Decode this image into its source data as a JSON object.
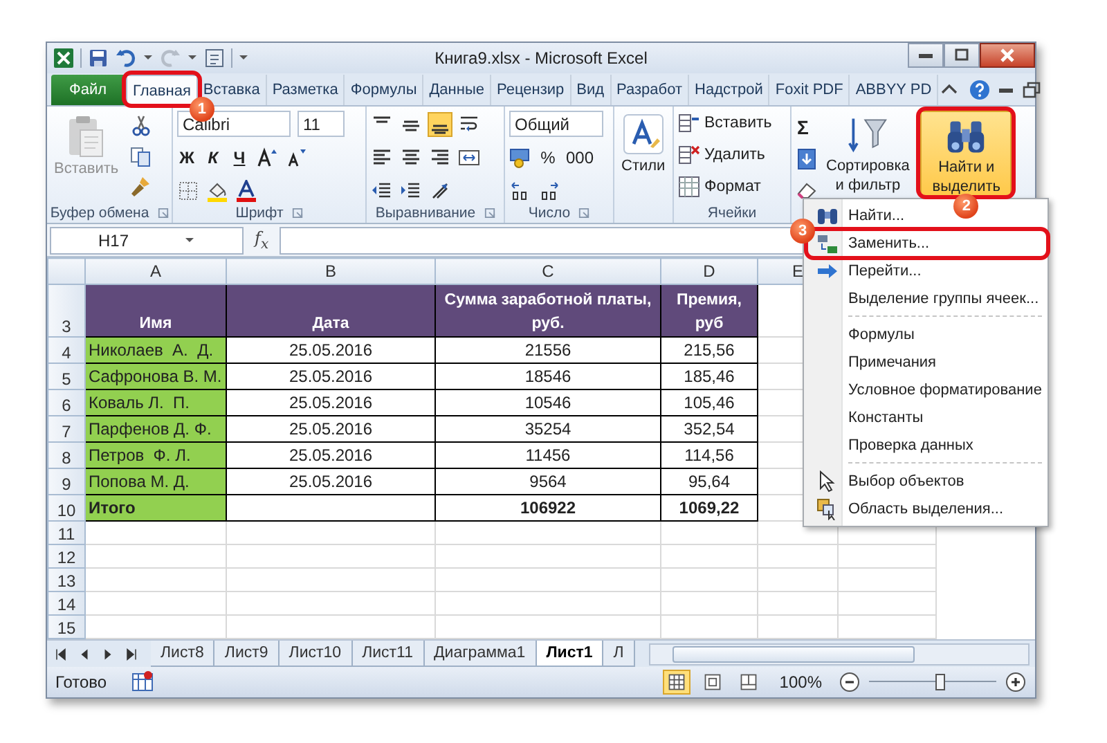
{
  "window": {
    "title": "Книга9.xlsx - Microsoft Excel"
  },
  "tabs": [
    {
      "label": "Файл",
      "kind": "file",
      "selected": false
    },
    {
      "label": "Главная",
      "kind": "tab",
      "selected": true,
      "callout": "1"
    },
    {
      "label": "Вставка",
      "kind": "tab",
      "selected": false
    },
    {
      "label": "Разметка",
      "kind": "tab",
      "selected": false
    },
    {
      "label": "Формулы",
      "kind": "tab",
      "selected": false
    },
    {
      "label": "Данные",
      "kind": "tab",
      "selected": false
    },
    {
      "label": "Рецензир",
      "kind": "tab",
      "selected": false
    },
    {
      "label": "Вид",
      "kind": "tab",
      "selected": false
    },
    {
      "label": "Разработ",
      "kind": "tab",
      "selected": false
    },
    {
      "label": "Надстрой",
      "kind": "tab",
      "selected": false
    },
    {
      "label": "Foxit PDF",
      "kind": "tab",
      "selected": false
    },
    {
      "label": "ABBYY PD",
      "kind": "tab",
      "selected": false
    }
  ],
  "ribbon": {
    "clipboard": {
      "paste": {
        "label": "Вставить",
        "disabled": true
      },
      "group_label": "Буфер обмена"
    },
    "font": {
      "name": "Calibri",
      "size": "11",
      "bold": "Ж",
      "italic": "К",
      "underline": "Ч",
      "group_label": "Шрифт"
    },
    "alignment": {
      "group_label": "Выравнивание"
    },
    "number": {
      "format": "Общий",
      "percent": "%",
      "thousands": "000",
      "group_label": "Число"
    },
    "styles": {
      "label": "Стили"
    },
    "cells": {
      "items": [
        "Вставить",
        "Удалить",
        "Формат"
      ],
      "group_label": "Ячейки"
    },
    "editing": {
      "sum": "Σ",
      "sort": {
        "lines": [
          "Сортировка",
          "и фильтр"
        ]
      },
      "find": {
        "lines": [
          "Найти и",
          "выделить"
        ],
        "selected": true,
        "callout": "2"
      }
    }
  },
  "formula_bar": {
    "name_box": "H17",
    "fx": "f$_{x}$"
  },
  "sheet": {
    "columns": [
      "A",
      "B",
      "C",
      "D",
      "E"
    ],
    "rows": [
      {
        "number": "3",
        "kind": "header",
        "cells": [
          "Имя",
          "Дата",
          "Сумма заработной платы, руб.",
          "Премия, руб"
        ]
      },
      {
        "number": "4",
        "kind": "data",
        "cells": [
          "Николаев  А.  Д.",
          "25.05.2016",
          "21556",
          "215,56"
        ]
      },
      {
        "number": "5",
        "kind": "data",
        "cells": [
          "Сафронова В. М.",
          "25.05.2016",
          "18546",
          "185,46"
        ]
      },
      {
        "number": "6",
        "kind": "data",
        "cells": [
          "Коваль Л.  П.",
          "25.05.2016",
          "10546",
          "105,46"
        ]
      },
      {
        "number": "7",
        "kind": "data",
        "cells": [
          "Парфенов Д. Ф.",
          "25.05.2016",
          "35254",
          "352,54"
        ]
      },
      {
        "number": "8",
        "kind": "data",
        "cells": [
          "Петров  Ф. Л.",
          "25.05.2016",
          "11456",
          "114,56"
        ]
      },
      {
        "number": "9",
        "kind": "data",
        "cells": [
          "Попова М. Д.",
          "25.05.2016",
          "9564",
          "95,64"
        ]
      },
      {
        "number": "10",
        "kind": "total",
        "cells": [
          "Итого",
          "",
          "106922",
          "1069,22"
        ]
      },
      {
        "number": "11",
        "kind": "empty"
      },
      {
        "number": "12",
        "kind": "empty"
      },
      {
        "number": "13",
        "kind": "empty"
      },
      {
        "number": "14",
        "kind": "empty"
      },
      {
        "number": "15",
        "kind": "empty"
      }
    ]
  },
  "sheet_tabs": [
    {
      "label": "Лист8",
      "selected": false
    },
    {
      "label": "Лист9",
      "selected": false
    },
    {
      "label": "Лист10",
      "selected": false
    },
    {
      "label": "Лист11",
      "selected": false
    },
    {
      "label": "Диаграмма1",
      "selected": false
    },
    {
      "label": "Лист1",
      "selected": true
    },
    {
      "label": "Л",
      "selected": false
    }
  ],
  "status_bar": {
    "text": "Готово",
    "views": [
      {
        "selected": true
      },
      {
        "selected": false
      },
      {
        "selected": false
      }
    ],
    "zoom": "100%",
    "zoom_slider": {
      "level": 0.55
    }
  },
  "menu": {
    "items": [
      {
        "label": "Найти...",
        "kind": "find",
        "separator_before": false
      },
      {
        "label": "Заменить...",
        "kind": "replace",
        "separator_before": false,
        "callout": "3"
      },
      {
        "label": "Перейти...",
        "kind": "goto",
        "separator_before": false
      },
      {
        "label": "Выделение группы ячеек...",
        "kind": "plain",
        "separator_before": false
      },
      {
        "label": "Формулы",
        "kind": "plain",
        "separator_before": true
      },
      {
        "label": "Примечания",
        "kind": "plain",
        "separator_before": false
      },
      {
        "label": "Условное форматирование",
        "kind": "plain",
        "separator_before": false
      },
      {
        "label": "Константы",
        "kind": "plain",
        "separator_before": false
      },
      {
        "label": "Проверка данных",
        "kind": "plain",
        "separator_before": false
      },
      {
        "label": "Выбор объектов",
        "kind": "pointer",
        "separator_before": true
      },
      {
        "label": "Область выделения...",
        "kind": "pane",
        "separator_before": false
      }
    ]
  }
}
